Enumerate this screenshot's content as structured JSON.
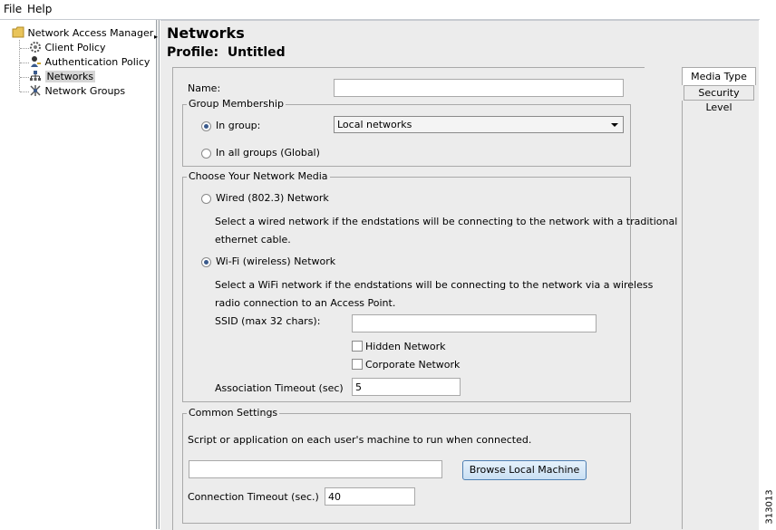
{
  "menubar": {
    "items": [
      "File",
      "Help"
    ]
  },
  "tree": {
    "root": "Network Access Manager",
    "items": [
      "Client Policy",
      "Authentication Policy",
      "Networks",
      "Network Groups"
    ],
    "selected": "Networks"
  },
  "header": {
    "title": "Networks",
    "profile_label": "Profile:",
    "profile_value": "Untitled"
  },
  "form": {
    "name_label": "Name:",
    "name_value": "",
    "group_membership": {
      "legend": "Group Membership",
      "in_group_label": "In group:",
      "in_group_value": "Local networks",
      "all_groups_label": "In all groups (Global)",
      "selected": "in_group"
    },
    "network_media": {
      "legend": "Choose Your Network Media",
      "wired_label": "Wired (802.3) Network",
      "wired_desc_1": "Select a wired network if the endstations will be connecting to the network with a traditional",
      "wired_desc_2": "ethernet cable.",
      "wifi_label": "Wi-Fi (wireless) Network",
      "wifi_desc_1": "Select a WiFi network if the endstations will be connecting to the network via a wireless",
      "wifi_desc_2": "radio connection to an Access Point.",
      "ssid_label": "SSID (max 32 chars):",
      "ssid_value": "",
      "hidden_label": "Hidden Network",
      "corporate_label": "Corporate Network",
      "assoc_label": "Association Timeout (sec)",
      "assoc_value": "5",
      "selected": "wifi"
    },
    "common_settings": {
      "legend": "Common Settings",
      "script_label": "Script or application on each user's machine to run when connected.",
      "script_value": "",
      "browse_label": "Browse Local Machine",
      "conn_timeout_label": "Connection Timeout (sec.)",
      "conn_timeout_value": "40"
    }
  },
  "side_tabs": [
    "Media Type",
    "Security Level"
  ],
  "figure_id": "313013",
  "colors": {
    "panel": "#ececec",
    "border": "#a9a9a9",
    "button_border": "#4d7fb3",
    "radio_dot": "#3a5a8c"
  }
}
